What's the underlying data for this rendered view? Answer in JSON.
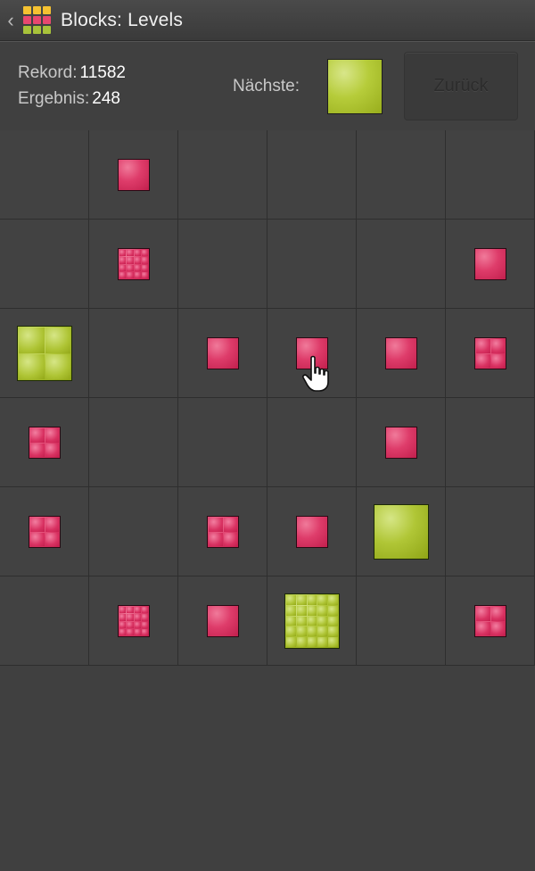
{
  "app": {
    "title": "Blocks: Levels",
    "back_chevron": "‹",
    "icon_colors": [
      "#f5c231",
      "#f5c231",
      "#f5c231",
      "#e8486f",
      "#e8486f",
      "#e8486f",
      "#a8c23a",
      "#a8c23a",
      "#a8c23a"
    ]
  },
  "stats": {
    "record_label": "Rekord:",
    "record_value": "11582",
    "score_label": "Ergebnis:",
    "score_value": "248",
    "next_label": "Nächste:",
    "next_block": "green",
    "back_button_label": "Zurück"
  },
  "board": {
    "columns": 6,
    "rows": 6,
    "cells": [
      [
        "",
        "pink-1",
        "",
        "",
        "",
        ""
      ],
      [
        "",
        "pink-16",
        "",
        "",
        "",
        "pink-1"
      ],
      [
        "green-4",
        "",
        "pink-1",
        "pink-1",
        "pink-1",
        "pink-4"
      ],
      [
        "pink-4",
        "",
        "",
        "",
        "pink-1",
        ""
      ],
      [
        "pink-4",
        "",
        "pink-4",
        "pink-1",
        "green-1",
        ""
      ],
      [
        "",
        "pink-16",
        "pink-1",
        "green-25",
        "",
        "pink-4"
      ]
    ]
  },
  "colors": {
    "pink": "#de3c6a",
    "green": "#b0c636",
    "background": "#404040"
  }
}
